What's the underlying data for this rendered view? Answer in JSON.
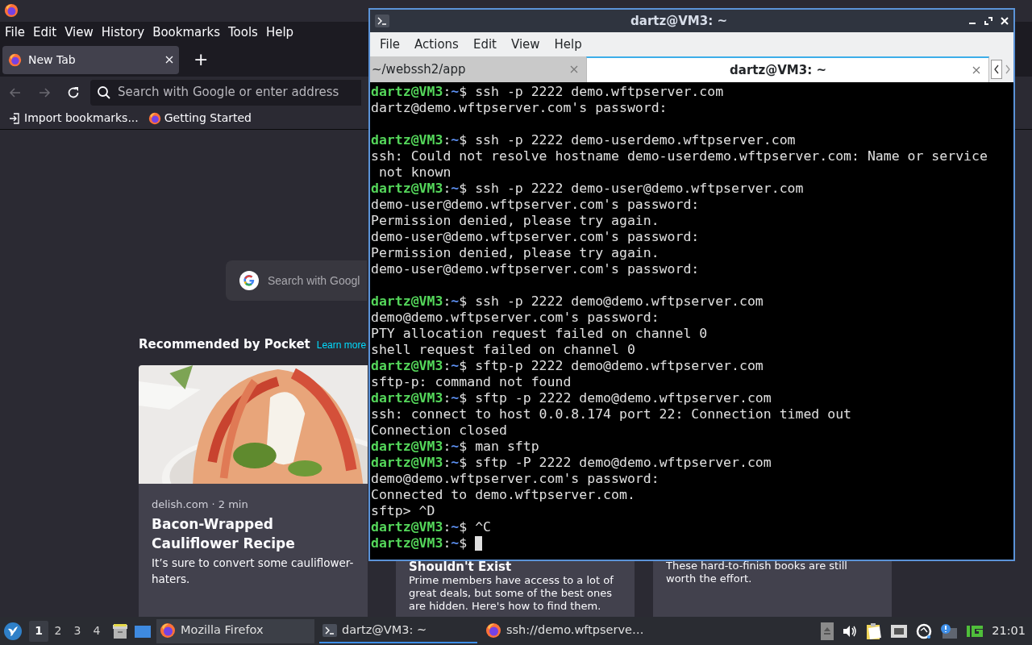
{
  "browser": {
    "menu": [
      "File",
      "Edit",
      "View",
      "History",
      "Bookmarks",
      "Tools",
      "Help"
    ],
    "tabs": [
      {
        "label": "New Tab",
        "selected": true
      }
    ],
    "new_tab": "+",
    "address_bar": {
      "placeholder": "Search with Google or enter address"
    },
    "bookmarks": [
      {
        "kind": "import",
        "label": "Import bookmarks..."
      },
      {
        "kind": "site",
        "label": "Getting Started"
      }
    ],
    "search": {
      "placeholder": "Search with Googl"
    },
    "pocket": {
      "heading": "Recommended by Pocket",
      "link": "Learn more",
      "cards": [
        {
          "kind": "picture",
          "source": "delish.com · 2 min",
          "title": "Bacon-Wrapped Cauliflower Recipe",
          "excerpt": "It’s sure to convert some cauliflower-haters."
        },
        {
          "kind": "covered",
          "title": "Shouldn't Exist",
          "excerpt": "Prime members have access to a lot of great deals, but some of the best ones are hidden. Here's how to find them."
        },
        {
          "kind": "covered",
          "excerpt": "These hard-to-finish books are still worth the effort."
        }
      ]
    }
  },
  "terminal": {
    "title": "dartz@VM3: ~",
    "menu": [
      "File",
      "Actions",
      "Edit",
      "View",
      "Help"
    ],
    "tabs": [
      {
        "label": "~/webssh2/app",
        "selected": false
      },
      {
        "label": "dartz@VM3: ~",
        "selected": true
      }
    ],
    "lines": [
      {
        "kind": "prompt",
        "user": "dartz@VM3",
        "sep": ":",
        "path": "~",
        "symbol": "$",
        "command": "ssh -p 2222 demo.wftpserver.com"
      },
      {
        "kind": "output",
        "text": "dartz@demo.wftpserver.com's password:"
      },
      {
        "kind": "blank"
      },
      {
        "kind": "prompt",
        "user": "dartz@VM3",
        "sep": ":",
        "path": "~",
        "symbol": "$",
        "command": "ssh -p 2222 demo-userdemo.wftpserver.com"
      },
      {
        "kind": "output",
        "text": "ssh: Could not resolve hostname demo-userdemo.wftpserver.com: Name or service"
      },
      {
        "kind": "output",
        "text": " not known"
      },
      {
        "kind": "prompt",
        "user": "dartz@VM3",
        "sep": ":",
        "path": "~",
        "symbol": "$",
        "command": "ssh -p 2222 demo-user@demo.wftpserver.com"
      },
      {
        "kind": "output",
        "text": "demo-user@demo.wftpserver.com's password:"
      },
      {
        "kind": "output",
        "text": "Permission denied, please try again."
      },
      {
        "kind": "output",
        "text": "demo-user@demo.wftpserver.com's password:"
      },
      {
        "kind": "output",
        "text": "Permission denied, please try again."
      },
      {
        "kind": "output",
        "text": "demo-user@demo.wftpserver.com's password:"
      },
      {
        "kind": "blank"
      },
      {
        "kind": "prompt",
        "user": "dartz@VM3",
        "sep": ":",
        "path": "~",
        "symbol": "$",
        "command": "ssh -p 2222 demo@demo.wftpserver.com"
      },
      {
        "kind": "output",
        "text": "demo@demo.wftpserver.com's password:"
      },
      {
        "kind": "output",
        "text": "PTY allocation request failed on channel 0"
      },
      {
        "kind": "output",
        "text": "shell request failed on channel 0"
      },
      {
        "kind": "prompt",
        "user": "dartz@VM3",
        "sep": ":",
        "path": "~",
        "symbol": "$",
        "command": "sftp-p 2222 demo@demo.wftpserver.com"
      },
      {
        "kind": "output",
        "text": "sftp-p: command not found"
      },
      {
        "kind": "prompt",
        "user": "dartz@VM3",
        "sep": ":",
        "path": "~",
        "symbol": "$",
        "command": "sftp -p 2222 demo@demo.wftpserver.com"
      },
      {
        "kind": "output",
        "text": "ssh: connect to host 0.0.8.174 port 22: Connection timed out"
      },
      {
        "kind": "output",
        "text": "Connection closed"
      },
      {
        "kind": "prompt",
        "user": "dartz@VM3",
        "sep": ":",
        "path": "~",
        "symbol": "$",
        "command": "man sftp"
      },
      {
        "kind": "prompt",
        "user": "dartz@VM3",
        "sep": ":",
        "path": "~",
        "symbol": "$",
        "command": "sftp -P 2222 demo@demo.wftpserver.com"
      },
      {
        "kind": "output",
        "text": "demo@demo.wftpserver.com's password:"
      },
      {
        "kind": "output",
        "text": "Connected to demo.wftpserver.com."
      },
      {
        "kind": "output",
        "text": "sftp> ^D"
      },
      {
        "kind": "prompt",
        "user": "dartz@VM3",
        "sep": ":",
        "path": "~",
        "symbol": "$",
        "command": "^C"
      },
      {
        "kind": "prompt",
        "user": "dartz@VM3",
        "sep": ":",
        "path": "~",
        "symbol": "$",
        "cursor": true
      }
    ]
  },
  "taskbar": {
    "workspaces": [
      {
        "label": "1",
        "selected": true
      },
      {
        "label": "2",
        "selected": false
      },
      {
        "label": "3",
        "selected": false
      },
      {
        "label": "4",
        "selected": false
      }
    ],
    "tasks": [
      {
        "kind": "firefox",
        "label": "Mozilla Firefox",
        "selected": false,
        "hovered": true
      },
      {
        "kind": "terminal",
        "label": "dartz@VM3: ~",
        "selected": true,
        "hovered": false
      },
      {
        "kind": "firefox",
        "label": "ssh://demo.wftpserve…",
        "selected": false,
        "hovered": false
      }
    ],
    "clock": "21:01"
  }
}
